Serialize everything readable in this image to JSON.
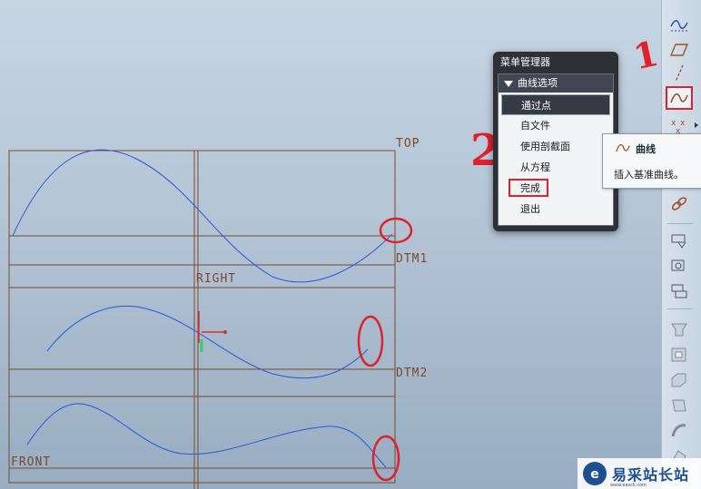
{
  "datums": {
    "top": "TOP",
    "dtm1": "DTM1",
    "right": "RIGHT",
    "dtm2": "DTM2",
    "front": "FRONT"
  },
  "menu_manager": {
    "title": "菜单管理器",
    "section": "曲线选项",
    "items": [
      "通过点",
      "自文件",
      "使用剖截面",
      "从方程",
      "完成",
      "退出"
    ],
    "selected": "通过点"
  },
  "tooltip": {
    "title": "曲线",
    "description": "插入基准曲线。"
  },
  "annotations": {
    "step1": "1",
    "step2": "2"
  },
  "toolbar_icons": [
    "sketch-curve-icon",
    "datum-plane-icon",
    "datum-axis-icon",
    "datum-curve-icon",
    "datum-point-icon",
    "coordinate-system-icon",
    "chain-icon",
    "view-icon-1",
    "view-icon-2",
    "view-icon-3",
    "feature-icon-1",
    "feature-icon-2",
    "feature-icon-3",
    "feature-icon-4",
    "feature-icon-5",
    "feature-icon-6"
  ],
  "watermark": {
    "text": "易采站长站",
    "sub": "www.easck.com"
  },
  "colors": {
    "datum_lines": "#7a4a2a",
    "curve": "#2f55d4",
    "highlight": "#e0202a",
    "menu_bg": "#2d3136"
  }
}
